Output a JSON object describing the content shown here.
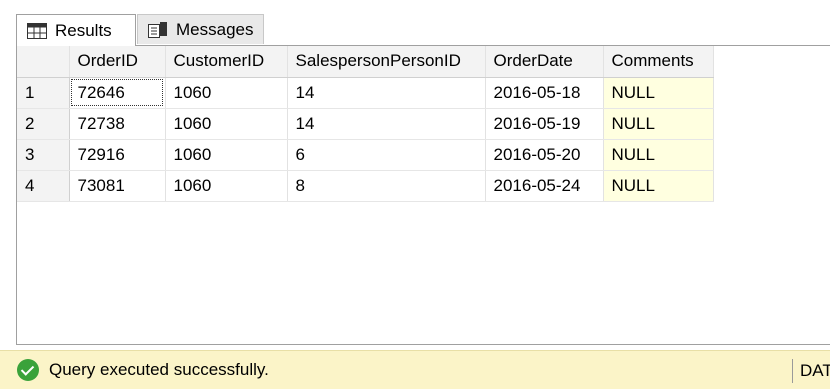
{
  "tabs": [
    {
      "label": "Results",
      "icon": "grid-icon"
    },
    {
      "label": "Messages",
      "icon": "messages-icon"
    }
  ],
  "grid": {
    "columns": [
      "OrderID",
      "CustomerID",
      "SalespersonPersonID",
      "OrderDate",
      "Comments"
    ],
    "rows": [
      {
        "num": "1",
        "cells": [
          "72646",
          "1060",
          "14",
          "2016-05-18",
          "NULL"
        ]
      },
      {
        "num": "2",
        "cells": [
          "72738",
          "1060",
          "14",
          "2016-05-19",
          "NULL"
        ]
      },
      {
        "num": "3",
        "cells": [
          "72916",
          "1060",
          "6",
          "2016-05-20",
          "NULL"
        ]
      },
      {
        "num": "4",
        "cells": [
          "73081",
          "1060",
          "8",
          "2016-05-24",
          "NULL"
        ]
      }
    ]
  },
  "status": {
    "message": "Query executed successfully.",
    "right_text": "DAT",
    "bar_color": "#fbf4c8"
  }
}
